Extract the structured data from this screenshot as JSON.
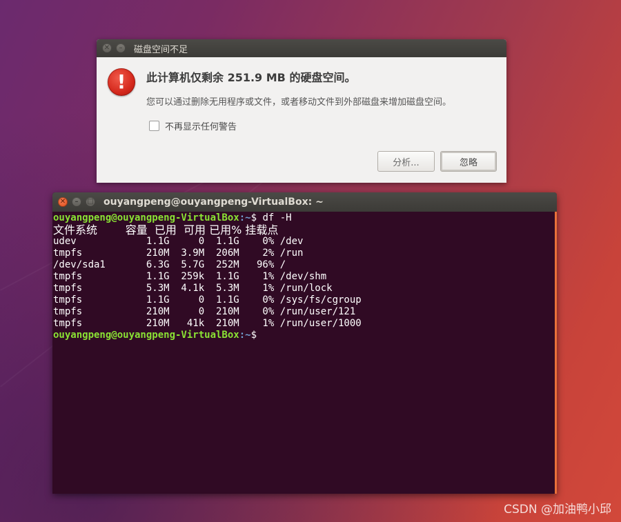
{
  "dialog": {
    "title": "磁盘空间不足",
    "headline": "此计算机仅剩余 251.9 MB 的硬盘空间。",
    "description": "您可以通过删除无用程序或文件，或者移动文件到外部磁盘来增加磁盘空间。",
    "checkbox_label": "不再显示任何警告",
    "analyze_label": "分析...",
    "ignore_label": "忽略",
    "icon": "warning-icon"
  },
  "terminal": {
    "title": "ouyangpeng@ouyangpeng-VirtualBox: ~",
    "prompt_user": "ouyangpeng@ouyangpeng-VirtualBox",
    "prompt_path": ":~",
    "prompt_symbol": "$ ",
    "command": "df -H",
    "header": "文件系统        容量  已用  可用 已用% 挂载点",
    "rows": [
      "udev            1.1G     0  1.1G    0% /dev",
      "tmpfs           210M  3.9M  206M    2% /run",
      "/dev/sda1       6.3G  5.7G  252M   96% /",
      "tmpfs           1.1G  259k  1.1G    1% /dev/shm",
      "tmpfs           5.3M  4.1k  5.3M    1% /run/lock",
      "tmpfs           1.1G     0  1.1G    0% /sys/fs/cgroup",
      "tmpfs           210M     0  210M    0% /run/user/121",
      "tmpfs           210M   41k  210M    1% /run/user/1000"
    ],
    "final_prompt_symbol": "$"
  },
  "watermark": "CSDN @加油鸭小邱"
}
